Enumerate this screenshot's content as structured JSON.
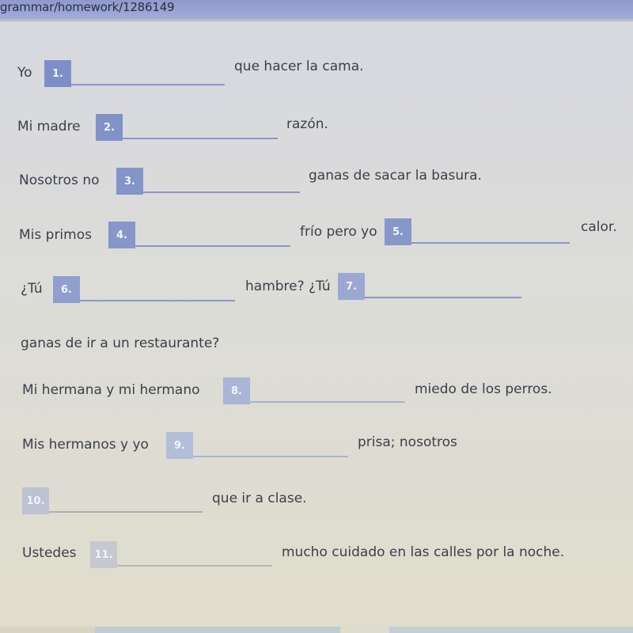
{
  "browser": {
    "url": "grammar/homework/1286149"
  },
  "exercise": {
    "items": [
      {
        "number": "1.",
        "before": "Yo",
        "after": "que hacer la cama.",
        "value": ""
      },
      {
        "number": "2.",
        "before": "Mi madre",
        "after": "razón.",
        "value": ""
      },
      {
        "number": "3.",
        "before": "Nosotros no",
        "after": "ganas de sacar la basura.",
        "value": ""
      },
      {
        "number": "4.",
        "before": "Mis primos",
        "after": "frío pero yo",
        "value": ""
      },
      {
        "number": "5.",
        "before": "",
        "after": "calor.",
        "value": ""
      },
      {
        "number": "6.",
        "before": "¿Tú",
        "after": "hambre? ¿Tú",
        "value": ""
      },
      {
        "number": "7.",
        "before": "",
        "after": "ganas de ir a un restaurante?",
        "value": ""
      },
      {
        "number": "8.",
        "before": "Mi hermana y mi hermano",
        "after": "miedo de los perros.",
        "value": ""
      },
      {
        "number": "9.",
        "before": "Mis hermanos y yo",
        "after": "prisa; nosotros",
        "value": ""
      },
      {
        "number": "10.",
        "before": "",
        "after": "que ir a clase.",
        "value": ""
      },
      {
        "number": "11.",
        "before": "Ustedes",
        "after": "mucho cuidado en las calles por la noche.",
        "value": ""
      }
    ]
  },
  "colors": {
    "badge_strong": "#7f90c8",
    "badge_faded": "#b4bdd6",
    "underline": "#8c97c5",
    "text": "#3a3f4a"
  }
}
